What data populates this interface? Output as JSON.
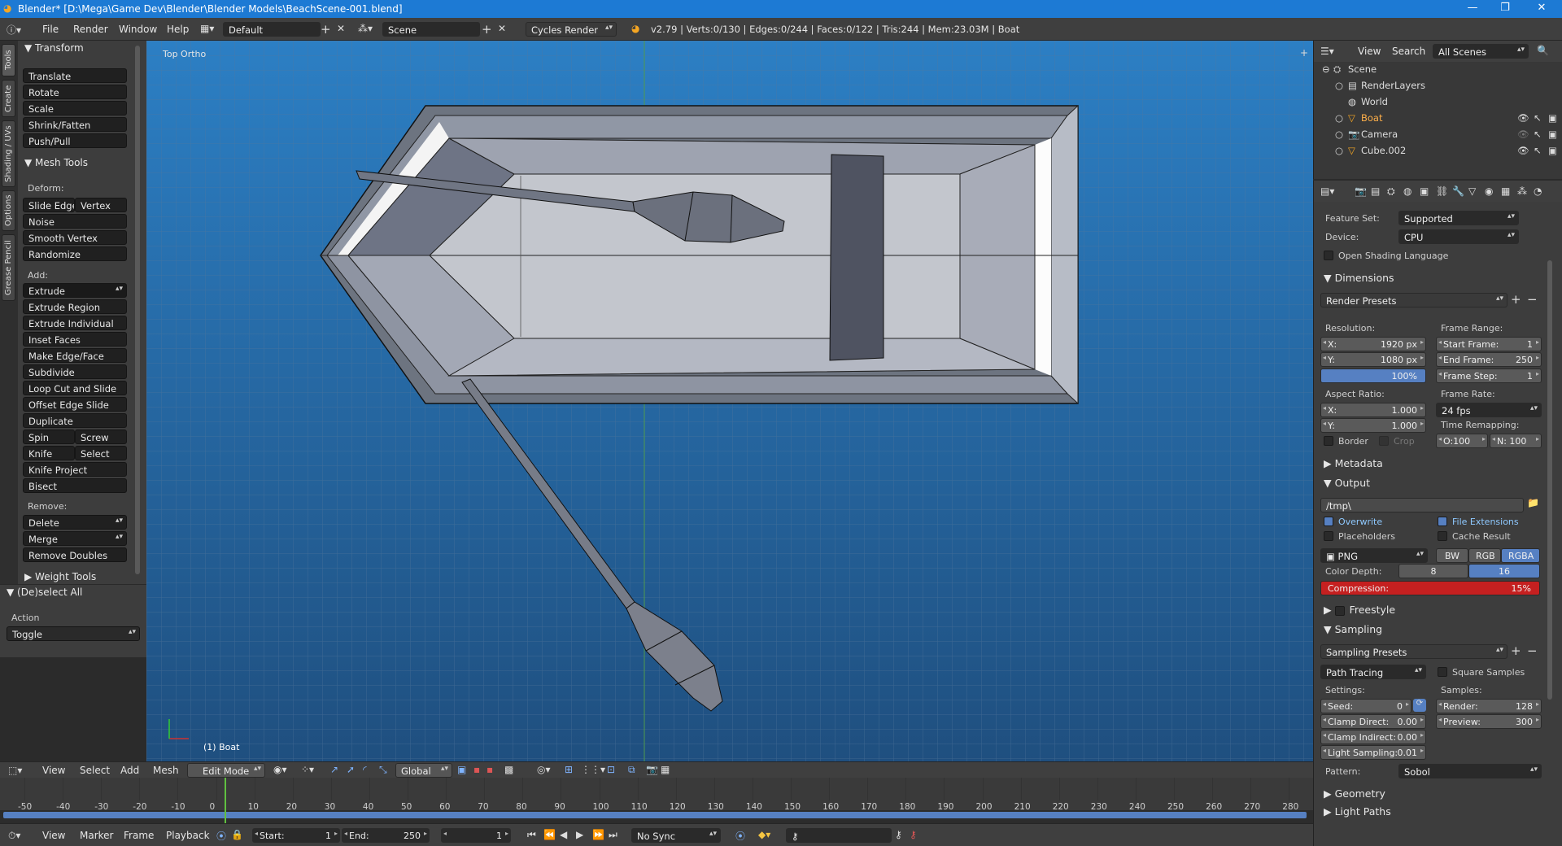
{
  "titlebar": {
    "title": "Blender* [D:\\Mega\\Game Dev\\Blender\\Blender Models\\BeachScene-001.blend]",
    "min": "—",
    "max": "❐",
    "close": "✕"
  },
  "infobar": {
    "menus": [
      "File",
      "Render",
      "Window",
      "Help"
    ],
    "layout": "Default",
    "scene": "Scene",
    "engine": "Cycles Render",
    "stats": "v2.79 | Verts:0/130 | Edges:0/244 | Faces:0/122 | Tris:244 | Mem:23.03M | Boat"
  },
  "lefttabs": [
    "Tools",
    "Create",
    "Shading / UVs",
    "Options",
    "Grease Pencil"
  ],
  "toolshelf": {
    "transform": {
      "title": "Transform",
      "items": [
        "Translate",
        "Rotate",
        "Scale",
        "Shrink/Fatten",
        "Push/Pull"
      ]
    },
    "meshtools": {
      "title": "Mesh Tools",
      "deform_label": "Deform:",
      "slide_edge": "Slide Edge",
      "vertex": "Vertex",
      "noise": "Noise",
      "smooth_vertex": "Smooth Vertex",
      "randomize": "Randomize",
      "add_label": "Add:",
      "extrude": "Extrude",
      "add_items": [
        "Extrude Region",
        "Extrude Individual",
        "Inset Faces",
        "Make Edge/Face",
        "Subdivide",
        "Loop Cut and Slide",
        "Offset Edge Slide",
        "Duplicate"
      ],
      "spin": "Spin",
      "screw": "Screw",
      "knife": "Knife",
      "select": "Select",
      "knife_project": "Knife Project",
      "bisect": "Bisect",
      "remove_label": "Remove:",
      "delete": "Delete",
      "merge": "Merge",
      "remove_doubles": "Remove Doubles"
    },
    "weighttools": "Weight Tools"
  },
  "lastop": {
    "title": "(De)select All",
    "action_label": "Action",
    "action_value": "Toggle"
  },
  "viewport": {
    "view_name": "Top Ortho",
    "object_label": "(1) Boat"
  },
  "vpheader": {
    "menus": [
      "View",
      "Select",
      "Add",
      "Mesh"
    ],
    "mode": "Edit Mode",
    "orientation": "Global"
  },
  "timeline": {
    "ticks": [
      "-50",
      "-40",
      "-30",
      "-20",
      "-10",
      "0",
      "10",
      "20",
      "30",
      "40",
      "50",
      "60",
      "70",
      "80",
      "90",
      "100",
      "110",
      "120",
      "130",
      "140",
      "150",
      "160",
      "170",
      "180",
      "190",
      "200",
      "210",
      "220",
      "230",
      "240",
      "250",
      "260",
      "270",
      "280"
    ]
  },
  "tlheader": {
    "menus": [
      "View",
      "Marker",
      "Frame",
      "Playback"
    ],
    "start_label": "Start:",
    "start": "1",
    "end_label": "End:",
    "end": "250",
    "current": "1",
    "sync": "No Sync"
  },
  "outliner": {
    "menus": [
      "View",
      "Search"
    ],
    "filter": "All Scenes",
    "items": [
      {
        "name": "Scene",
        "indent": 0
      },
      {
        "name": "RenderLayers",
        "indent": 1
      },
      {
        "name": "World",
        "indent": 1
      },
      {
        "name": "Boat",
        "indent": 1
      },
      {
        "name": "Camera",
        "indent": 1
      },
      {
        "name": "Cube.002",
        "indent": 1
      }
    ]
  },
  "props": {
    "feature_set_label": "Feature Set:",
    "feature_set": "Supported",
    "device_label": "Device:",
    "device": "CPU",
    "osl": "Open Shading Language",
    "dimensions": "Dimensions",
    "render_presets": "Render Presets",
    "resolution_label": "Resolution:",
    "res_x": "1920 px",
    "res_y": "1080 px",
    "res_pct": "100%",
    "frame_range_label": "Frame Range:",
    "start_frame": "1",
    "end_frame": "250",
    "frame_step": "1",
    "start_frame_label": "Start Frame:",
    "end_frame_label": "End Frame:",
    "frame_step_label": "Frame Step:",
    "aspect_label": "Aspect Ratio:",
    "aspect_x": "1.000",
    "aspect_y": "1.000",
    "frame_rate_label": "Frame Rate:",
    "frame_rate": "24 fps",
    "time_remap_label": "Time Remapping:",
    "remap_old": "O:100",
    "remap_new": "N: 100",
    "border": "Border",
    "crop": "Crop",
    "metadata": "Metadata",
    "output": "Output",
    "output_path": "/tmp\\",
    "overwrite": "Overwrite",
    "file_ext": "File Extensions",
    "placeholders": "Placeholders",
    "cache_result": "Cache Result",
    "format": "PNG",
    "bw": "BW",
    "rgb": "RGB",
    "rgba": "RGBA",
    "color_depth_label": "Color Depth:",
    "depth8": "8",
    "depth16": "16",
    "compression_label": "Compression:",
    "compression": "15%",
    "freestyle": "Freestyle",
    "sampling": "Sampling",
    "sampling_presets": "Sampling Presets",
    "integrator": "Path Tracing",
    "square_samples": "Square Samples",
    "settings_label": "Settings:",
    "samples_label": "Samples:",
    "seed_label": "Seed:",
    "seed": "0",
    "render_label": "Render:",
    "render": "128",
    "clamp_direct_label": "Clamp Direct:",
    "clamp_direct": "0.00",
    "preview_label": "Preview:",
    "preview": "300",
    "clamp_indirect_label": "Clamp Indirect:",
    "clamp_indirect": "0.00",
    "light_sampling_label": "Light Sampling:",
    "light_sampling": "0.01",
    "pattern_label": "Pattern:",
    "pattern": "Sobol",
    "geometry": "Geometry",
    "light_paths": "Light Paths"
  },
  "colors": {
    "accent": "#5680c2",
    "titlebar": "#1d7ad4",
    "compression": "#c52020",
    "viewport_bg": "#3a5a7a",
    "grid": "#4f6f8f"
  }
}
